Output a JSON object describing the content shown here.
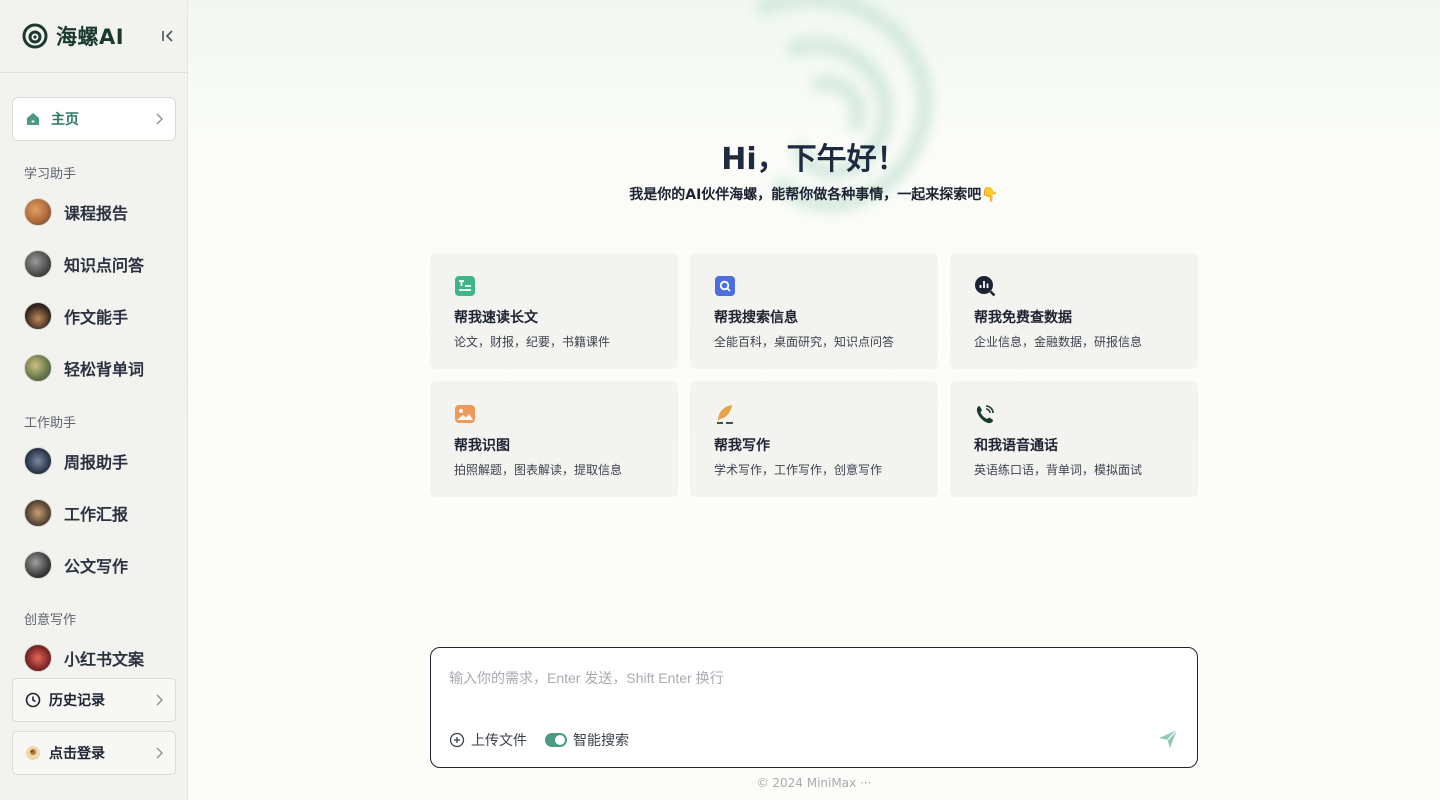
{
  "brand": {
    "name": "海螺AI"
  },
  "sidebar": {
    "home_label": "主页",
    "sections": [
      {
        "title": "学习助手",
        "items": [
          {
            "label": "课程报告",
            "color": "#b06a3c"
          },
          {
            "label": "知识点问答",
            "color": "#4a4a4a"
          },
          {
            "label": "作文能手",
            "color": "#3a2a22"
          },
          {
            "label": "轻松背单词",
            "color": "#6a7a4a"
          }
        ]
      },
      {
        "title": "工作助手",
        "items": [
          {
            "label": "周报助手",
            "color": "#2e3a50"
          },
          {
            "label": "工作汇报",
            "color": "#5a4838"
          },
          {
            "label": "公文写作",
            "color": "#3c3c3c"
          }
        ]
      },
      {
        "title": "创意写作",
        "items": [
          {
            "label": "小红书文案",
            "color": "#8a2a2a"
          }
        ]
      }
    ],
    "history_label": "历史记录",
    "login_label": "点击登录"
  },
  "main": {
    "greeting": "Hi，下午好！",
    "subline": "我是你的AI伙伴海螺，能帮你做各种事情，一起来探索吧👇",
    "cards": [
      {
        "title": "帮我速读长文",
        "desc": "论文，财报，纪要，书籍课件",
        "icon": "document-summary-icon",
        "color": "#3fb58a"
      },
      {
        "title": "帮我搜索信息",
        "desc": "全能百科，桌面研究，知识点问答",
        "icon": "search-doc-icon",
        "color": "#4b6fe0"
      },
      {
        "title": "帮我免费查数据",
        "desc": "企业信息，金融数据，研报信息",
        "icon": "data-search-icon",
        "color": "#1d2332"
      },
      {
        "title": "帮我识图",
        "desc": "拍照解题，图表解读，提取信息",
        "icon": "image-icon",
        "color": "#ee9a5a"
      },
      {
        "title": "帮我写作",
        "desc": "学术写作，工作写作，创意写作",
        "icon": "feather-pen-icon",
        "color": "#e8a24a"
      },
      {
        "title": "和我语音通话",
        "desc": "英语练口语，背单词，模拟面试",
        "icon": "phone-call-icon",
        "color": "#1a3a30"
      }
    ]
  },
  "input": {
    "placeholder": "输入你的需求，Enter 发送，Shift Enter 换行",
    "upload_label": "上传文件",
    "search_label": "智能搜索"
  },
  "footer": {
    "text": "© 2024 MiniMax ···"
  }
}
